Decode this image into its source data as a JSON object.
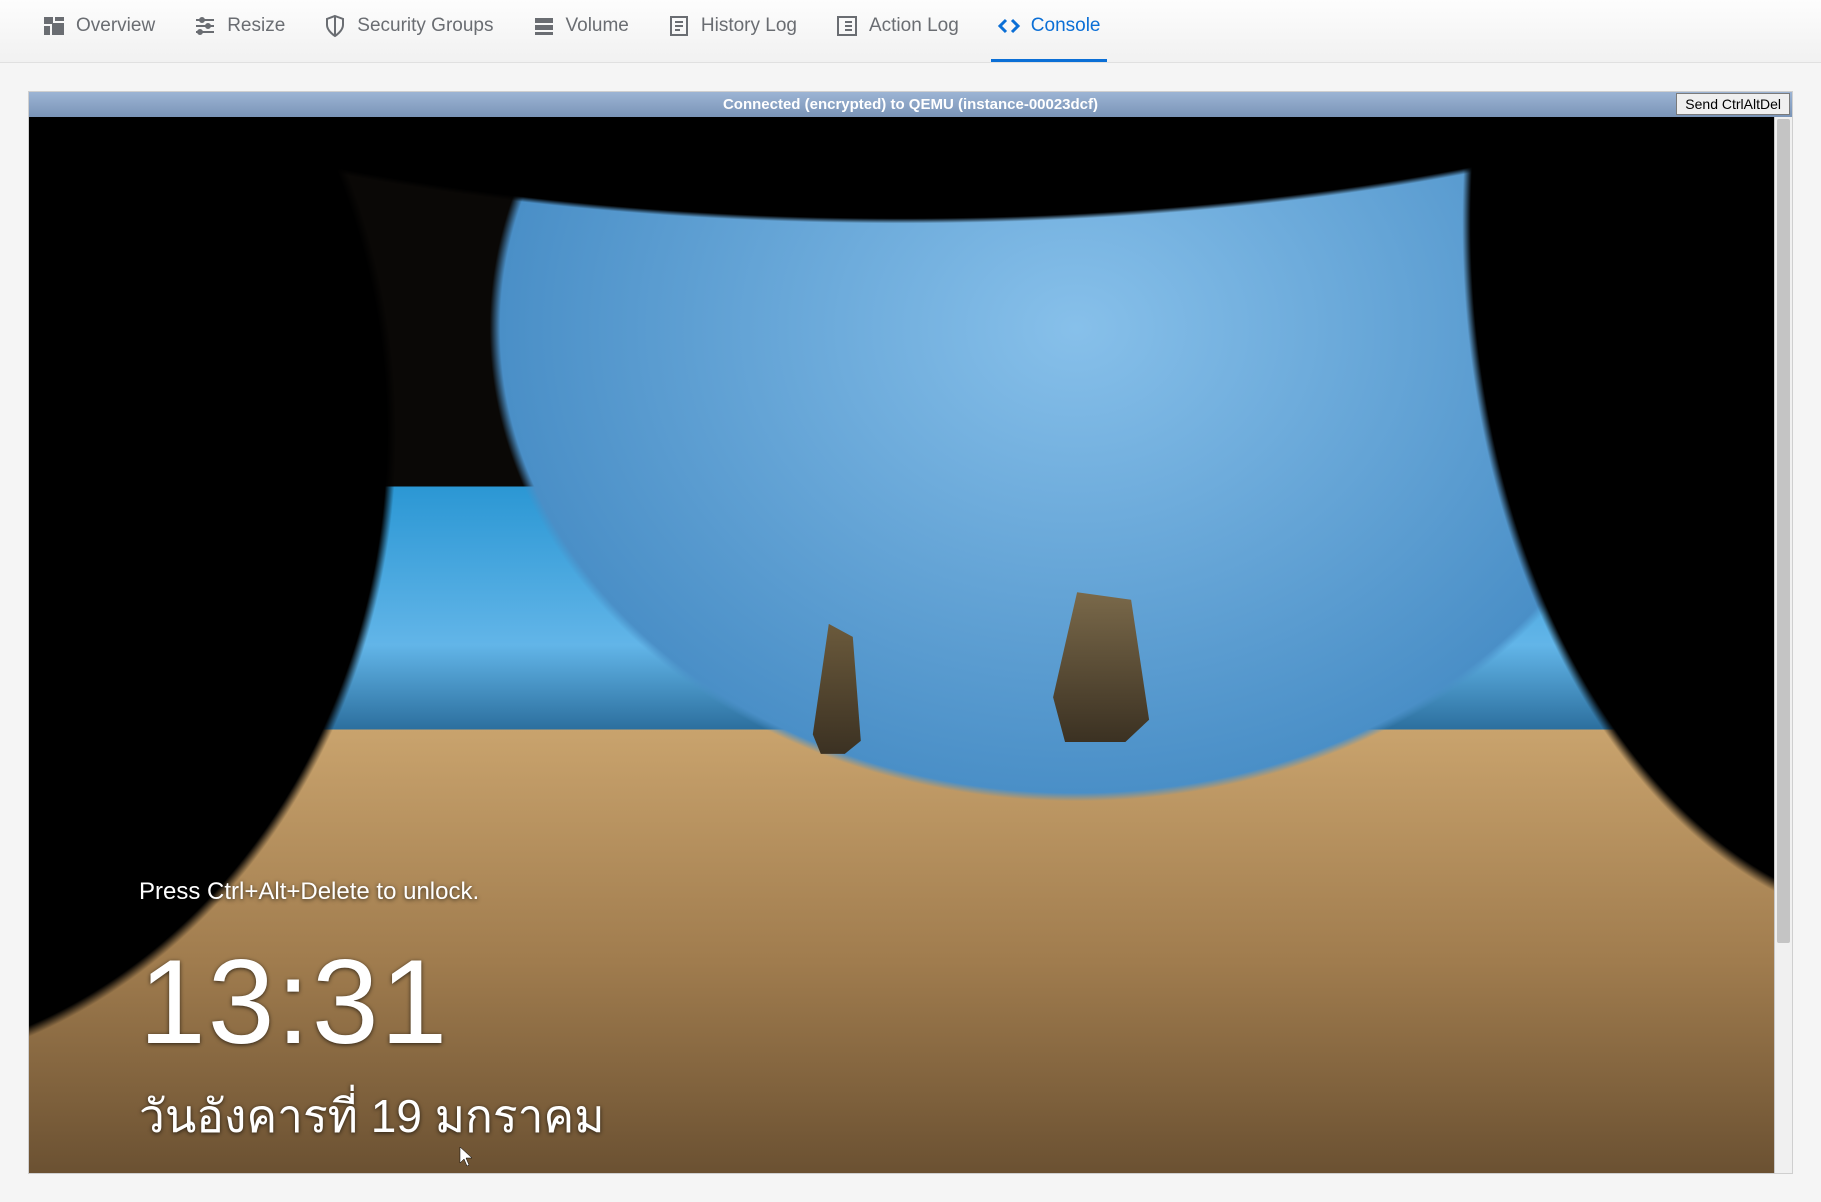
{
  "tabs": {
    "overview": "Overview",
    "resize": "Resize",
    "security_groups": "Security Groups",
    "volume": "Volume",
    "history_log": "History Log",
    "action_log": "Action Log",
    "console": "Console",
    "active": "console"
  },
  "vnc": {
    "status": "Connected (encrypted) to QEMU (instance-00023dcf)",
    "send_cad_label": "Send CtrlAltDel"
  },
  "lockscreen": {
    "unlock_hint": "Press Ctrl+Alt+Delete to unlock.",
    "time": "13:31",
    "date": "วันอังคารที่ 19 มกราคม"
  },
  "colors": {
    "accent": "#0b6fd6",
    "tab_text": "#6a6d72"
  }
}
